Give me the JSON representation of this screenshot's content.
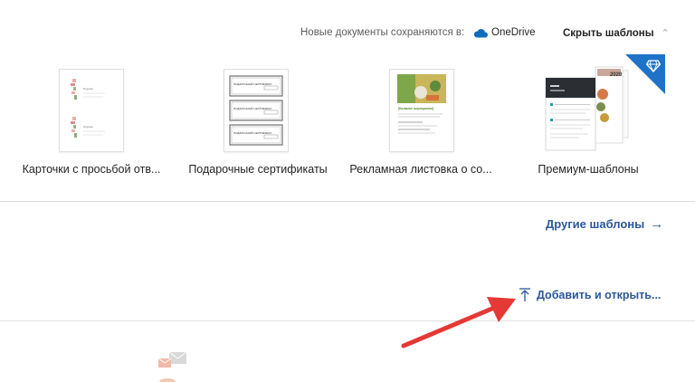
{
  "header": {
    "save_note": "Новые документы сохраняются в:",
    "onedrive_label": "OneDrive",
    "hide_templates": "Скрыть шаблоны"
  },
  "templates": [
    {
      "label": "Карточки с просьбой отв...",
      "thumb_text": "Хорошо"
    },
    {
      "label": "Подарочные сертификаты",
      "thumb_text": "ПОДАРОЧНЫЙ СЕРТИФИКАТ"
    },
    {
      "label": "Рекламная листовка о со...",
      "thumb_text": "[Название мероприятия]"
    },
    {
      "label": "Премиум-шаблоны",
      "thumb_text": "2020"
    }
  ],
  "more_templates": "Другие шаблоны",
  "upload_open": "Добавить и открыть...",
  "colors": {
    "link": "#2b579a",
    "premium_badge": "#1e73c8",
    "onedrive": "#0f6cbd",
    "arrow": "#e53935"
  },
  "icons": {
    "onedrive": "cloud-icon",
    "hide_chevron": "chevron-up-icon",
    "more_arrow": "arrow-right-icon",
    "upload": "upload-icon",
    "premium": "diamond-icon"
  }
}
